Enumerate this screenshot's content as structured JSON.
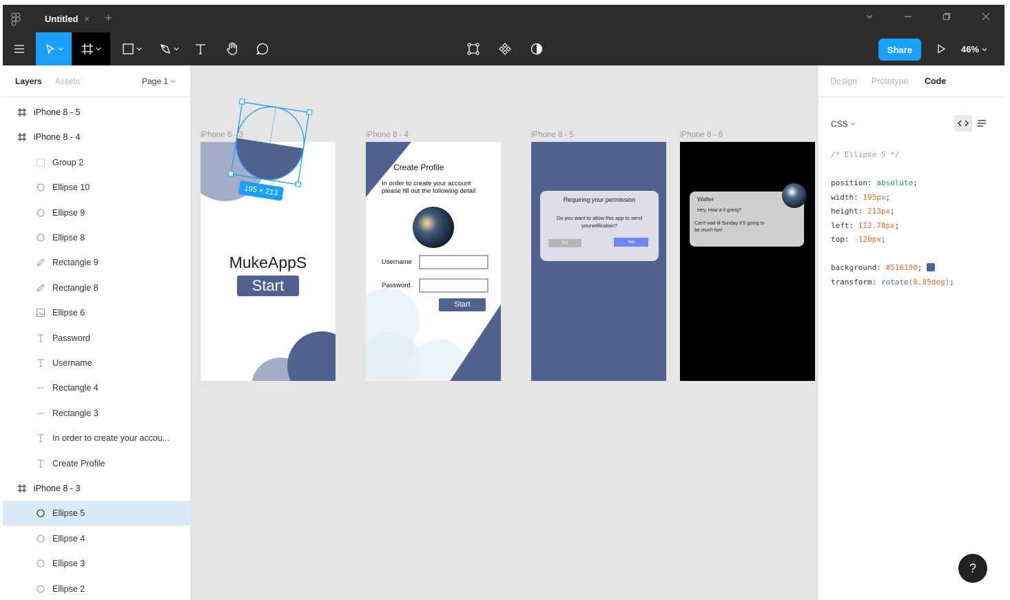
{
  "titlebar": {
    "tab_title": "Untitled",
    "tab_close": "×",
    "new_tab": "+"
  },
  "toolbar": {
    "share_label": "Share",
    "zoom": "46%"
  },
  "left_panel": {
    "tabs": [
      "Layers",
      "Assets"
    ],
    "page": "Page 1",
    "layers": [
      {
        "label": "iPhone 8 - 5",
        "icon": "frame-icon",
        "indent": 0
      },
      {
        "label": "iPhone 8 - 4",
        "icon": "frame-icon",
        "indent": 0
      },
      {
        "label": "Group 2",
        "icon": "group-icon",
        "indent": 1
      },
      {
        "label": "Ellipse 10",
        "icon": "ellipse-icon",
        "indent": 1
      },
      {
        "label": "Ellipse 9",
        "icon": "ellipse-icon",
        "indent": 1
      },
      {
        "label": "Ellipse 8",
        "icon": "ellipse-icon",
        "indent": 1
      },
      {
        "label": "Rectangle 9",
        "icon": "rect-rotated-icon",
        "indent": 1
      },
      {
        "label": "Rectangle 8",
        "icon": "rect-rotated-icon",
        "indent": 1
      },
      {
        "label": "Ellipse 6",
        "icon": "image-icon",
        "indent": 1
      },
      {
        "label": "Password",
        "icon": "text-icon",
        "indent": 1
      },
      {
        "label": "Username",
        "icon": "text-icon",
        "indent": 1
      },
      {
        "label": "Rectangle 4",
        "icon": "line-rect-icon",
        "indent": 1
      },
      {
        "label": "Rectangle 3",
        "icon": "line-rect-icon",
        "indent": 1
      },
      {
        "label": "In order to create your accou...",
        "icon": "text-icon",
        "indent": 1
      },
      {
        "label": "Create Profile",
        "icon": "text-icon",
        "indent": 1
      },
      {
        "label": "iPhone 8 - 3",
        "icon": "frame-icon",
        "indent": 0
      },
      {
        "label": "Ellipse 5",
        "icon": "ellipse-icon",
        "indent": 1,
        "selected": true
      },
      {
        "label": "Ellipse 4",
        "icon": "ellipse-icon",
        "indent": 1
      },
      {
        "label": "Ellipse 3",
        "icon": "ellipse-icon",
        "indent": 1
      },
      {
        "label": "Ellipse 2",
        "icon": "ellipse-icon",
        "indent": 1
      }
    ]
  },
  "canvas": {
    "frame_labels": [
      "iPhone 8 - 3",
      "iPhone 8 - 4",
      "iPhone 8 - 5",
      "iPhone 8 - 6"
    ],
    "selection_size": "195 × 213",
    "frame3": {
      "app_name": "MukeAppS",
      "start": "Start"
    },
    "frame4": {
      "title": "Create Profile",
      "subtitle_line1": "In order to create your  account",
      "subtitle_line2": "please fill out the following detail",
      "username": "Username",
      "password": "Password",
      "start": "Start"
    },
    "frame5": {
      "dialog_title": "Requiring your permission",
      "dialog_body_1": "Do you want to allow this app to send",
      "dialog_body_2": "younotification?",
      "no": "No",
      "yes": "Yes"
    },
    "frame6": {
      "sender": "Walter",
      "line1": "Hey, How a it going?",
      "line2": "Can't wait til Sunday it'S going to",
      "line3": "be much fun!"
    }
  },
  "right_panel": {
    "tabs": [
      "Design",
      "Prototype",
      "Code"
    ],
    "active_tab": "Code",
    "language": "CSS",
    "code": {
      "comment": "/* Ellipse 5 */",
      "lines": [
        {
          "prop": "position",
          "value": "absolute"
        },
        {
          "prop": "width",
          "value": "195px"
        },
        {
          "prop": "height",
          "value": "213px"
        },
        {
          "prop": "left",
          "value": "112.78px"
        },
        {
          "prop": "top",
          "value": "-120px"
        }
      ],
      "background_prop": "background",
      "background_value": "#516190",
      "transform_prop": "transform",
      "transform_fn": "rotate",
      "transform_arg": "(8.85deg)"
    }
  },
  "help_label": "?",
  "colors": {
    "accent": "#18a0fb",
    "frame_blue": "#516190",
    "frame_light_blue": "#a3aec6"
  }
}
